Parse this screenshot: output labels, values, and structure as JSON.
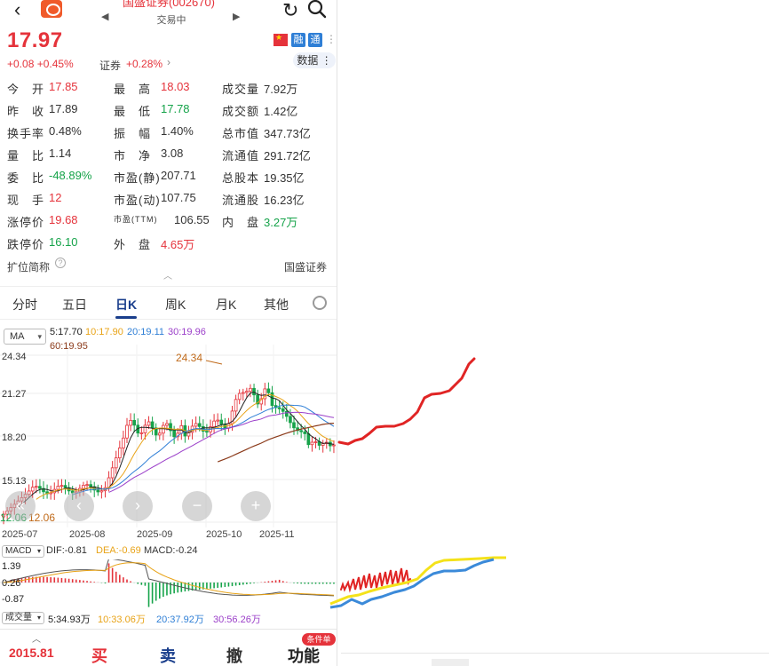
{
  "header": {
    "title": "国盛证券(002670)",
    "status": "交易中",
    "back_icon": "chevron-left-icon",
    "refresh_icon": "refresh-icon",
    "search_icon": "search-icon"
  },
  "quote": {
    "price": "17.97",
    "change": "+0.08  +0.45%",
    "sector": "证券",
    "sector_change": "+0.28%",
    "sector_arrow": "›",
    "badges": [
      "融",
      "通"
    ],
    "data_button": "数据",
    "rows": [
      [
        [
          "今　开",
          "17.85",
          "red"
        ],
        [
          "最　高",
          "18.03",
          "red"
        ],
        [
          "成交量",
          "7.92万",
          ""
        ]
      ],
      [
        [
          "昨　收",
          "17.89",
          ""
        ],
        [
          "最　低",
          "17.78",
          "green"
        ],
        [
          "成交额",
          "1.42亿",
          ""
        ]
      ],
      [
        [
          "换手率",
          "0.48%",
          ""
        ],
        [
          "振　幅",
          "1.40%",
          ""
        ],
        [
          "总市值",
          "347.73亿",
          ""
        ]
      ],
      [
        [
          "量　比",
          "1.14",
          ""
        ],
        [
          "市　净",
          "3.08",
          ""
        ],
        [
          "流通值",
          "291.72亿",
          ""
        ]
      ],
      [
        [
          "委　比",
          "-48.89%",
          "green"
        ],
        [
          "市盈(静)",
          "207.71",
          ""
        ],
        [
          "总股本",
          "19.35亿",
          ""
        ]
      ],
      [
        [
          "现　手",
          "12",
          "red"
        ],
        [
          "市盈(动)",
          "107.75",
          ""
        ],
        [
          "流通股",
          "16.23亿",
          ""
        ]
      ],
      [
        [
          "涨停价",
          "19.68",
          "red"
        ],
        [
          "市盈(TTM)",
          "106.55",
          ""
        ],
        [
          "内　盘",
          "3.27万",
          "green"
        ]
      ],
      [
        [
          "跌停价",
          "16.10",
          "green"
        ],
        [
          "外　盘",
          "4.65万",
          "red"
        ]
      ]
    ],
    "kuowei": "扩位简称",
    "broker": "国盛证券"
  },
  "tabs": [
    {
      "label": "分时",
      "active": false
    },
    {
      "label": "五日",
      "active": false
    },
    {
      "label": "日K",
      "active": true
    },
    {
      "label": "周K",
      "active": false
    },
    {
      "label": "月K",
      "active": false
    },
    {
      "label": "其他",
      "active": false
    }
  ],
  "kchart": {
    "ma_select": "MA",
    "ma_legend": [
      {
        "text": "5:17.70",
        "color": "#222222"
      },
      {
        "text": "10:17.90",
        "color": "#e8a317"
      },
      {
        "text": "20:19.11",
        "color": "#2f7fd6"
      },
      {
        "text": "30:19.96",
        "color": "#9b3fc9"
      },
      {
        "text": "60:19.95",
        "color": "#8b3a1a"
      }
    ],
    "y_labels": [
      "24.34",
      "21.27",
      "18.20",
      "15.13"
    ],
    "high_annotation": "24.34",
    "low_annotation": "12.06",
    "low_annotation_left": "12.06",
    "x_labels": [
      "2025-07",
      "2025-08",
      "2025-09",
      "2025-10",
      "2025-11"
    ],
    "nav_buttons": [
      "«",
      "‹",
      "›",
      "−",
      "+"
    ]
  },
  "macd": {
    "select": "MACD",
    "legend": [
      {
        "text": "DIF:-0.81",
        "color": "#333333"
      },
      {
        "text": "DEA:-0.69",
        "color": "#e8a317"
      },
      {
        "text": "MACD:-0.24",
        "color": "#333333"
      }
    ],
    "y_labels": [
      "1.39",
      "0.26",
      "-0.87"
    ]
  },
  "volume": {
    "select": "成交量",
    "legend": [
      {
        "text": "5:34.93万",
        "color": "#222222"
      },
      {
        "text": "10:33.06万",
        "color": "#e8a317"
      },
      {
        "text": "20:37.92万",
        "color": "#2f7fd6"
      },
      {
        "text": "30:56.26万",
        "color": "#9b3fc9"
      }
    ]
  },
  "bottom": {
    "index_value": "2015.81",
    "buy": "买",
    "sell": "卖",
    "cancel": "撤",
    "function": "功能",
    "conditional": "条件单"
  }
}
